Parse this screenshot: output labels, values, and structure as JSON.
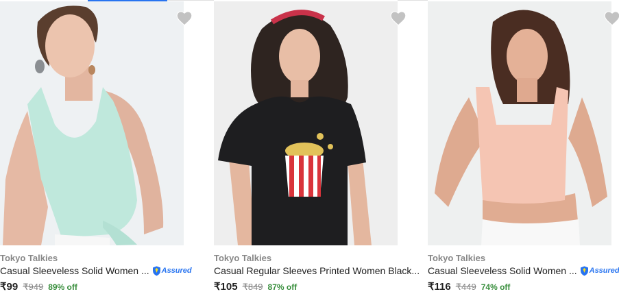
{
  "colors": {
    "accent": "#2874f0",
    "discount": "#388e3c",
    "muted": "#878787",
    "text": "#212121",
    "wishlist": "#c2c2c2"
  },
  "products": [
    {
      "brand": "Tokyo Talkies",
      "title": "Casual Sleeveless Solid Women ...",
      "assured": true,
      "assured_label": "Assured",
      "price": "₹99",
      "mrp": "₹949",
      "discount": "89% off",
      "image": "model-in-mint-sleeveless-crop-top",
      "wishlist_icon": "heart-icon"
    },
    {
      "brand": "Tokyo Talkies",
      "title": "Casual Regular Sleeves Printed Women Black...",
      "assured": false,
      "price": "₹105",
      "mrp": "₹849",
      "discount": "87% off",
      "image": "model-in-black-popcorn-print-tshirt",
      "wishlist_icon": "heart-icon"
    },
    {
      "brand": "Tokyo Talkies",
      "title": "Casual Sleeveless Solid Women ...",
      "assured": true,
      "assured_label": "Assured",
      "price": "₹116",
      "mrp": "₹449",
      "discount": "74% off",
      "image": "model-in-peach-sleeveless-crop-top",
      "wishlist_icon": "heart-icon"
    }
  ]
}
